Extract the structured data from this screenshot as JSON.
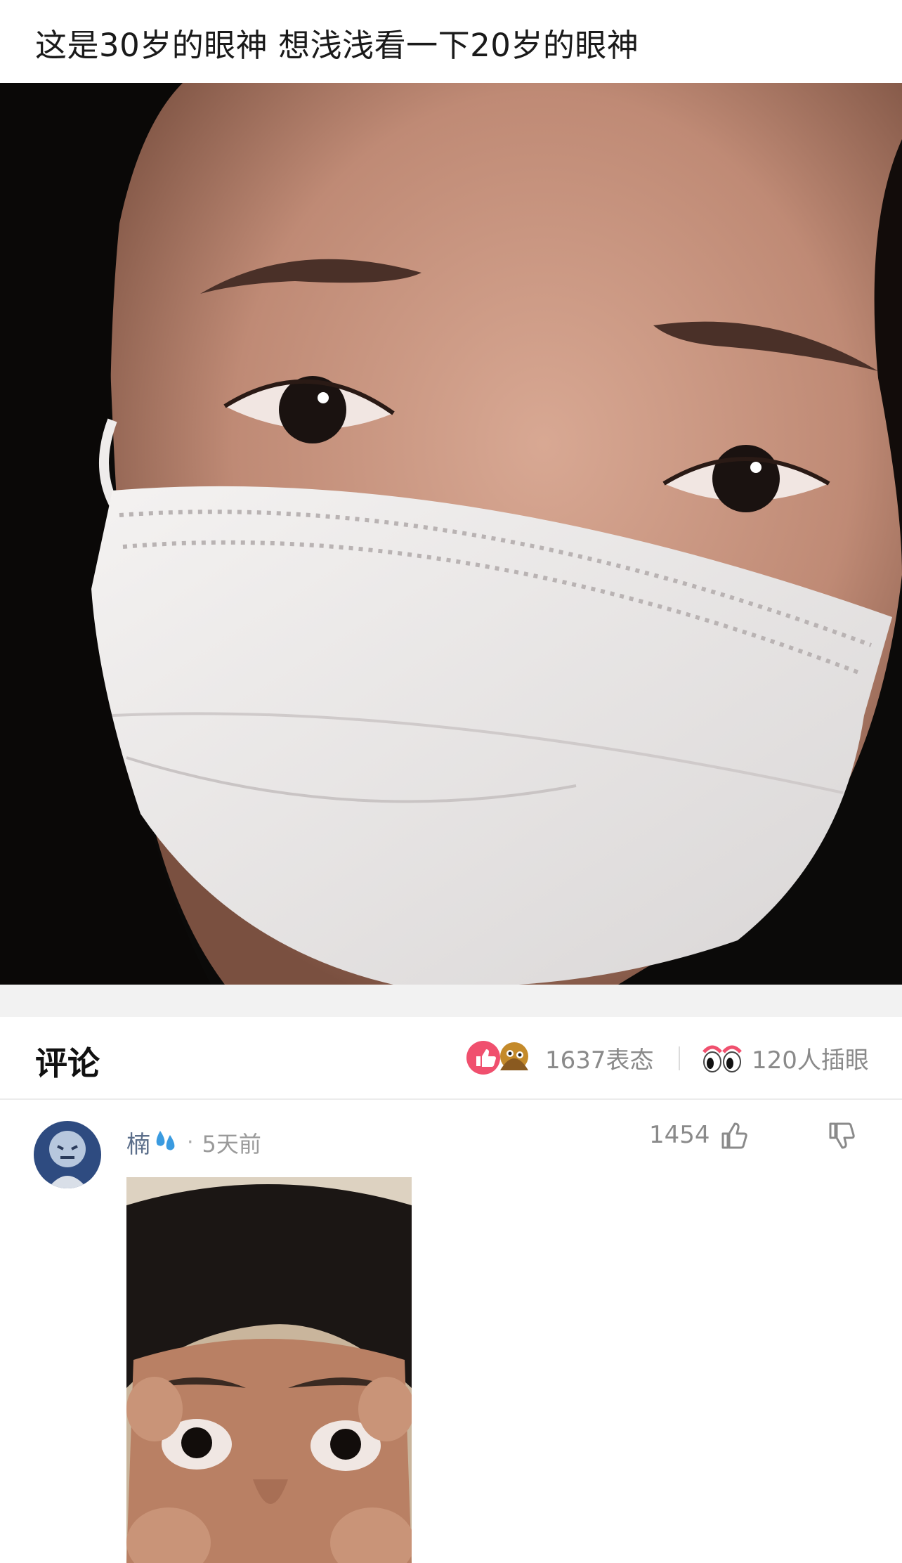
{
  "post": {
    "title": "这是30岁的眼神 想浅浅看一下20岁的眼神"
  },
  "comments_section": {
    "title": "评论",
    "reactions_label": "1637表态",
    "eye_label": "120人插眼"
  },
  "comment": {
    "username": "楠",
    "separator": "·",
    "time": "5天前",
    "likes": "1454"
  },
  "colors": {
    "like_badge": "#f0506e",
    "username": "#5b6e8a",
    "meta": "#8a8a8a"
  },
  "icons": [
    "like-reaction-icon",
    "emoji-reaction-icon",
    "eyes-icon",
    "thumbs-up-icon",
    "thumbs-down-icon",
    "sweat-drops-icon"
  ]
}
